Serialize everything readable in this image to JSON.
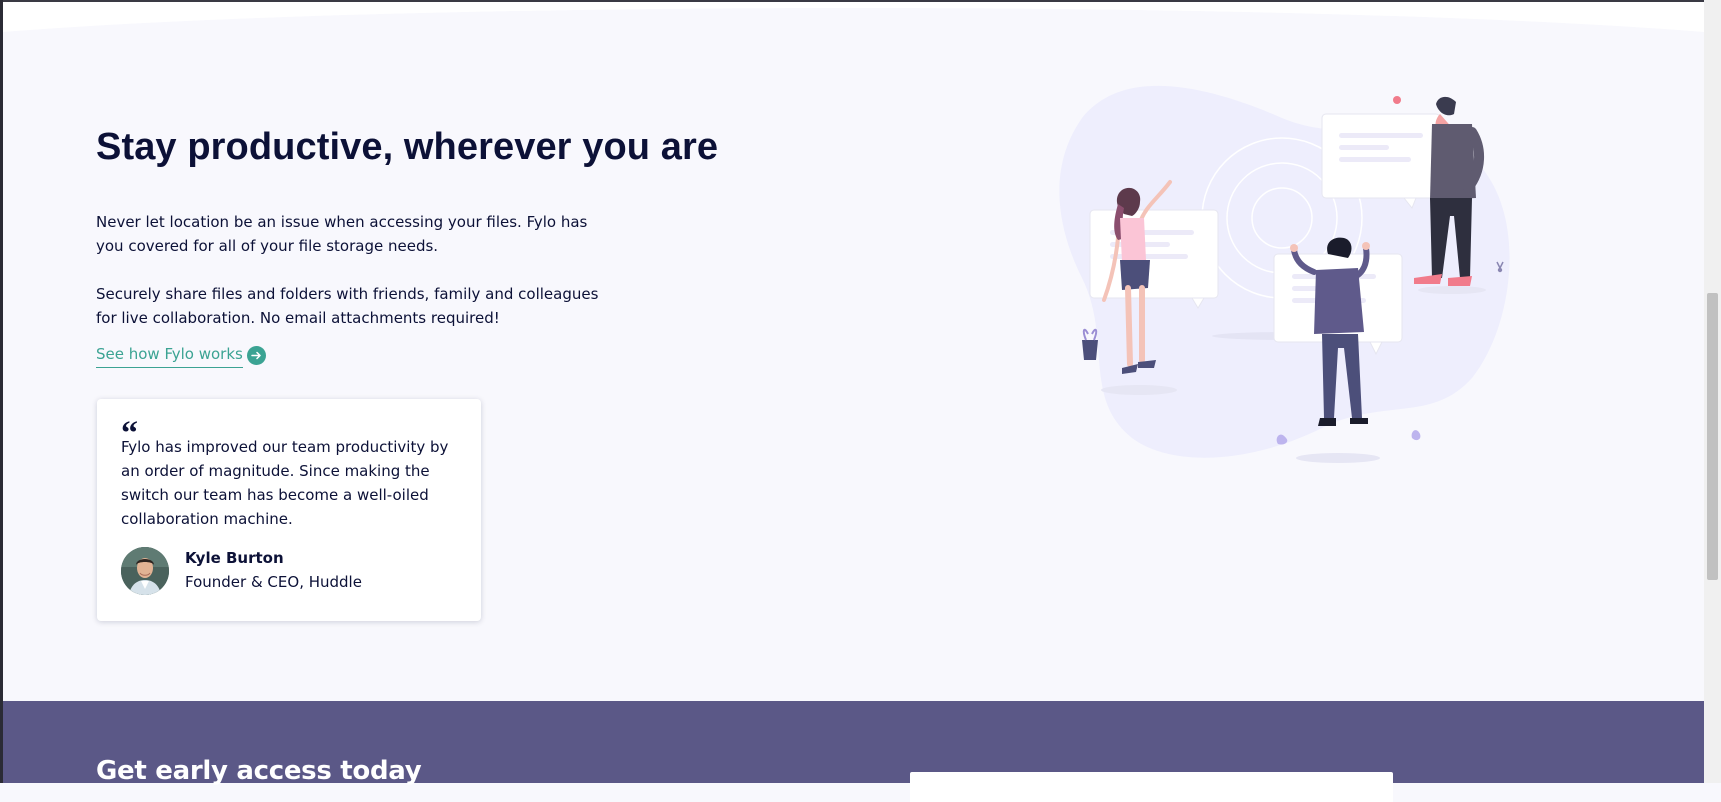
{
  "section": {
    "title": "Stay productive, wherever you are",
    "paragraph_1": "Never let location be an issue when accessing your files. Fylo has you covered for all of your file storage needs.",
    "paragraph_2": "Securely share files and folders with friends, family and colleagues for live collaboration. No email attachments required!",
    "link_label": "See how Fylo works",
    "link_icon": "arrow-right-circle-icon"
  },
  "testimonial": {
    "quote_mark": "“",
    "quote": "Fylo has improved our team productivity by an order of magnitude. Since making the switch our team has become a well-oiled collaboration machine.",
    "name": "Kyle Burton",
    "role": "Founder & CEO, Huddle"
  },
  "cta": {
    "title": "Get early access today"
  },
  "colors": {
    "background": "#f8f8fd",
    "heading": "#0c1137",
    "accent": "#3ba393",
    "cta_band": "#5b5887"
  }
}
